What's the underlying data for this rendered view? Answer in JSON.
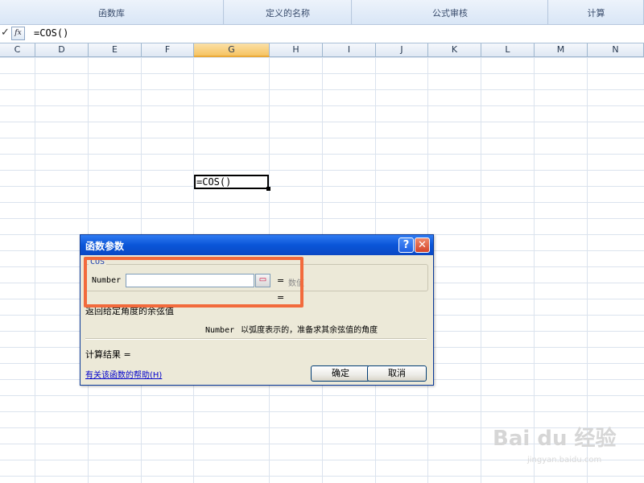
{
  "ribbon": {
    "groups": [
      {
        "label": "函数库"
      },
      {
        "label": "定义的名称"
      },
      {
        "label": "公式审核"
      },
      {
        "label": "计算"
      }
    ]
  },
  "formula_bar": {
    "check_icon": "check-icon",
    "fx_label": "fx",
    "formula": "=COS()"
  },
  "columns": [
    "C",
    "D",
    "E",
    "F",
    "G",
    "H",
    "I",
    "J",
    "K",
    "L",
    "M",
    "N"
  ],
  "selected_column": "G",
  "active_cell": {
    "content": "=COS()"
  },
  "dialog": {
    "title": "函数参数",
    "help_button": "?",
    "close_button": "✕",
    "function_name": "COS",
    "argument": {
      "label": "Number",
      "value": "",
      "eval_prefix": "=",
      "eval_value": "数值"
    },
    "result_eq": "=",
    "description": "返回给定角度的余弦值",
    "arg_description": {
      "name": "Number",
      "text": "以弧度表示的，准备求其余弦值的角度"
    },
    "result_label": "计算结果 =",
    "help_link": "有关该函数的帮助(H)",
    "ok_label": "确定",
    "cancel_label": "取消"
  },
  "watermark": {
    "logo": "Bai du 经验",
    "url": "jingyan.baidu.com"
  },
  "colors": {
    "highlight": "#f26a3c",
    "title_bar": "#0a55d8",
    "selected_column": "#f6c462"
  }
}
